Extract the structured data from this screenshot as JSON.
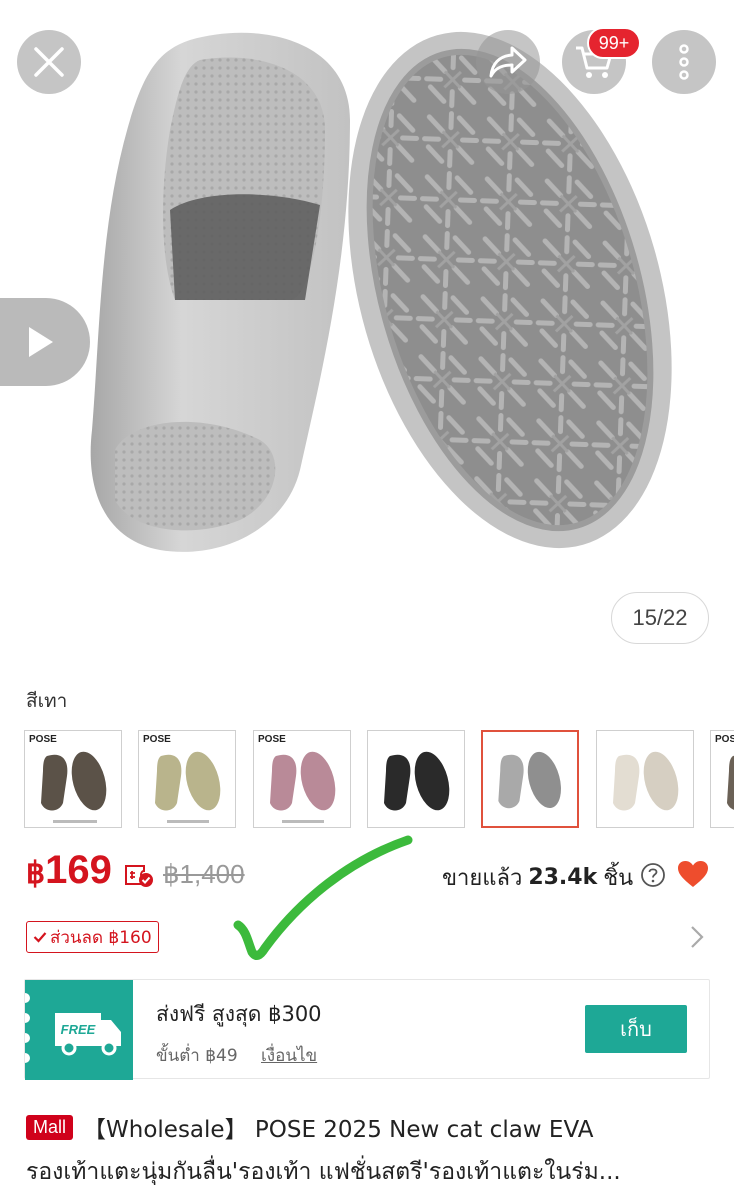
{
  "top_bar": {
    "cart_badge": "99+"
  },
  "gallery": {
    "counter": "15/22"
  },
  "variation": {
    "selected_label": "สีเทา",
    "thumbs": [
      {
        "brand": "POSE",
        "color": "#5b5248"
      },
      {
        "brand": "POSE",
        "color": "#b9b48c"
      },
      {
        "brand": "POSE",
        "color": "#b98a98"
      },
      {
        "brand": "",
        "color": "#2a2a2a"
      },
      {
        "brand": "",
        "color": "#a9a9a9"
      },
      {
        "brand": "",
        "color": "#e3ddd2"
      },
      {
        "brand": "POSE",
        "color": "#6b6156"
      }
    ],
    "selected_index": 4
  },
  "price": {
    "currency": "฿",
    "value": "169",
    "original": "฿1,400",
    "sold_label": "ขายแล้ว",
    "sold_count": "23.4k",
    "sold_unit": "ชิ้น",
    "discount": "ส่วนลด ฿160"
  },
  "voucher": {
    "badge": "FREE",
    "title": "ส่งฟรี สูงสุด ฿300",
    "min_spend": "ขั้นต่ำ ฿49",
    "conditions": "เงื่อนไข",
    "claim": "เก็บ"
  },
  "product": {
    "mall_badge": "Mall",
    "title_line1": "【Wholesale】 POSE 2025 New cat claw EVA",
    "title_line2": "รองเท้าแตะนุ่มกันลื่น'รองเท้า แฟชั่นสตรี'รองเท้าแตะในร่ม..."
  },
  "colors": {
    "price_red": "#d4141e",
    "teal": "#1ea896",
    "heart": "#ee4d2d",
    "check_green": "#3cba3c"
  }
}
